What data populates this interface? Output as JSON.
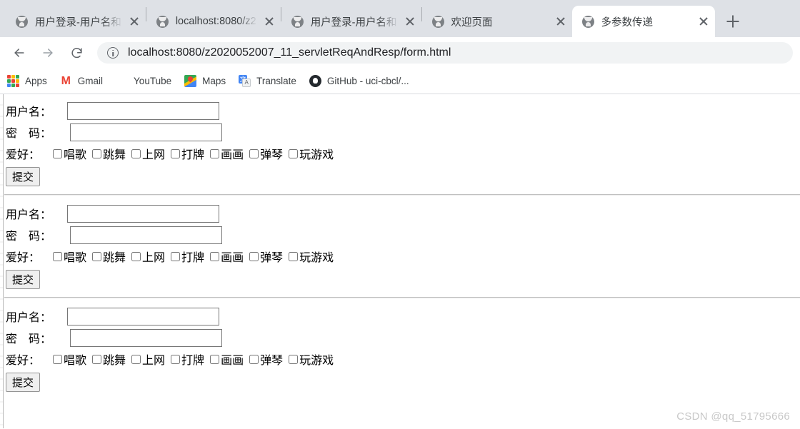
{
  "browser": {
    "tabs": [
      {
        "title": "用户登录-用户名和",
        "active": false,
        "truncated": true
      },
      {
        "title": "localhost:8080/z2",
        "active": false,
        "truncated": true
      },
      {
        "title": "用户登录-用户名和",
        "active": false,
        "truncated": true
      },
      {
        "title": "欢迎页面",
        "active": false,
        "truncated": false
      },
      {
        "title": "多参数传递",
        "active": true,
        "truncated": false
      }
    ],
    "new_tab_label": "+",
    "close_label": "×",
    "nav": {
      "back_icon": "back-arrow-icon",
      "forward_icon": "forward-arrow-icon",
      "reload_icon": "reload-icon"
    },
    "omnibox": {
      "site_info_icon": "site-info-icon",
      "url": "localhost:8080/z2020052007_11_servletReqAndResp/form.html"
    },
    "bookmarks": [
      {
        "label": "Apps",
        "icon": "apps-grid-icon"
      },
      {
        "label": "Gmail",
        "icon": "gmail-icon"
      },
      {
        "label": "YouTube",
        "icon": "youtube-icon"
      },
      {
        "label": "Maps",
        "icon": "maps-icon"
      },
      {
        "label": "Translate",
        "icon": "translate-icon"
      },
      {
        "label": "GitHub - uci-cbcl/...",
        "icon": "github-icon"
      }
    ]
  },
  "page": {
    "form": {
      "username_label": "用户名：",
      "password_label": "密　码：",
      "hobby_label": "爱好：",
      "username_value": "",
      "password_value": "",
      "hobbies": [
        "唱歌",
        "跳舞",
        "上网",
        "打牌",
        "画画",
        "玩游戏"
      ],
      "hobby_options": [
        "唱歌",
        "跳舞",
        "上网",
        "打牌",
        "画画",
        "弹琴",
        "玩游戏"
      ],
      "submit_label": "提交"
    },
    "form_count": 3,
    "watermark": "CSDN @qq_51795666"
  },
  "colors": {
    "tabstrip_bg": "#dee1e6",
    "active_tab_bg": "#ffffff",
    "omnibox_bg": "#f1f3f4",
    "text": "#3c4043",
    "watermark": "#c8c8c8"
  }
}
